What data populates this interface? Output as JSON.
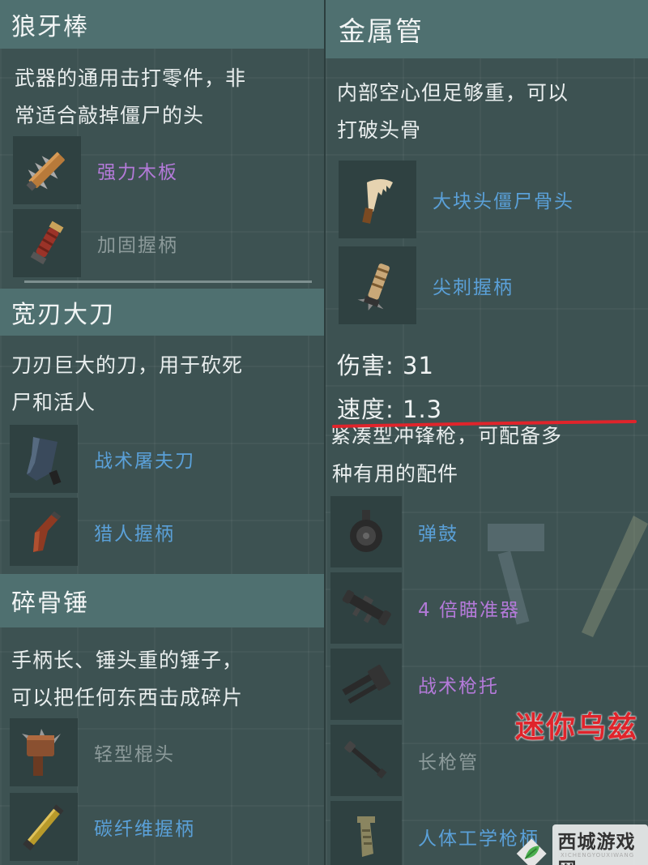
{
  "panels": {
    "wolf_club": {
      "title": "狼牙棒",
      "desc_line1": "武器的通用击打零件，非",
      "desc_line2": "常适合敲掉僵尸的头",
      "items": [
        {
          "label": "强力木板",
          "icon": "spiked-plank-icon",
          "color": "purple"
        },
        {
          "label": "加固握柄",
          "icon": "reinforced-grip-icon",
          "color": "gray"
        }
      ]
    },
    "metal_pipe": {
      "title": "金属管",
      "desc_line1": "内部空心但足够重，可以",
      "desc_line2": "打破头骨",
      "items": [
        {
          "label": "大块头僵尸骨头",
          "icon": "bone-icon",
          "color": "blue"
        },
        {
          "label": "尖刺握柄",
          "icon": "spiked-grip-icon",
          "color": "blue"
        }
      ],
      "stats": {
        "damage": "伤害: 31",
        "speed": "速度: 1.3"
      }
    },
    "machete": {
      "title": "宽刃大刀",
      "desc_line1": "刀刃巨大的刀，用于砍死",
      "desc_line2": "尸和活人",
      "items": [
        {
          "label": "战术屠夫刀",
          "icon": "cleaver-icon",
          "color": "blue"
        },
        {
          "label": "猎人握柄",
          "icon": "hunter-grip-icon",
          "color": "blue"
        }
      ]
    },
    "rifle": {
      "cut_line": "紧凑型冲锋枪，可配备多",
      "desc_line2": "种有用的配件",
      "items": [
        {
          "label": "弹鼓",
          "icon": "drum-magazine-icon",
          "color": "blue"
        },
        {
          "label": "4 倍瞄准器",
          "icon": "scope-icon",
          "color": "purple"
        },
        {
          "label": "战术枪托",
          "icon": "stock-icon",
          "color": "purple"
        },
        {
          "label": "长枪管",
          "icon": "long-barrel-icon",
          "color": "gray"
        },
        {
          "label": "人体工学枪柄",
          "icon": "ergonomic-grip-icon",
          "color": "blue"
        }
      ]
    },
    "bone_hammer": {
      "title": "碎骨锤",
      "desc_line1": "手柄长、锤头重的锤子，",
      "desc_line2": "可以把任何东西击成碎片",
      "items": [
        {
          "label": "轻型棍头",
          "icon": "light-club-head-icon",
          "color": "gray"
        },
        {
          "label": "碳纤维握柄",
          "icon": "carbon-grip-icon",
          "color": "blue"
        }
      ]
    }
  },
  "watermark": "迷你乌兹",
  "logo": {
    "text": "西城游戏网",
    "sub": "XICHENGYOUXIWANG"
  },
  "colors": {
    "purple": "#b47ad9",
    "blue": "#5aa0d8",
    "gray": "#8c9a9a",
    "red": "#e0242b"
  }
}
